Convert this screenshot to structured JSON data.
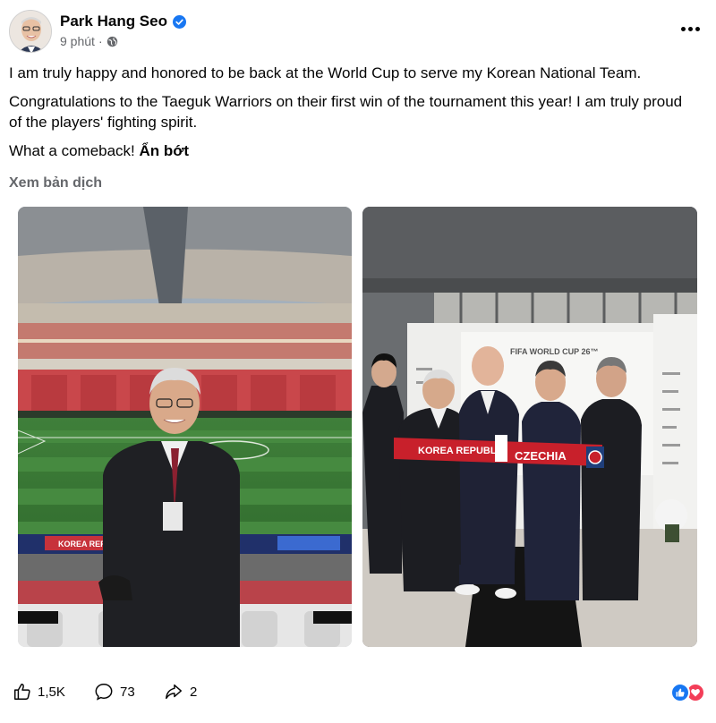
{
  "post": {
    "author": "Park Hang Seo",
    "time": "9 phút",
    "separator": "·",
    "privacy_icon": "globe-icon",
    "verified_icon": "verified-badge-icon",
    "paragraphs": [
      "I am truly happy and honored to be back at the World Cup to serve my Korean National Team.",
      "Congratulations to the Taeguk Warriors on their first win of the tournament this year! I am truly proud of the players' fighting spirit.",
      "What a comeback!"
    ],
    "see_less": "Ẩn bớt",
    "translate": "Xem bản dịch"
  },
  "photos": {
    "left": {
      "board_text": "KOREA REP"
    },
    "right": {
      "backdrop_title": "FIFA WORLD CUP 26™",
      "scarf_left": "KOREA REPUBLIC",
      "scarf_right": "CZECHIA"
    }
  },
  "footer": {
    "likes": "1,5K",
    "comments": "73",
    "shares": "2",
    "like_icon": "thumbs-up-icon",
    "comment_icon": "comment-icon",
    "share_icon": "share-icon"
  },
  "colors": {
    "text": "#050505",
    "secondary": "#65676b",
    "verified": "#1877f2",
    "like": "#1877f2",
    "love": "#f33e58"
  }
}
